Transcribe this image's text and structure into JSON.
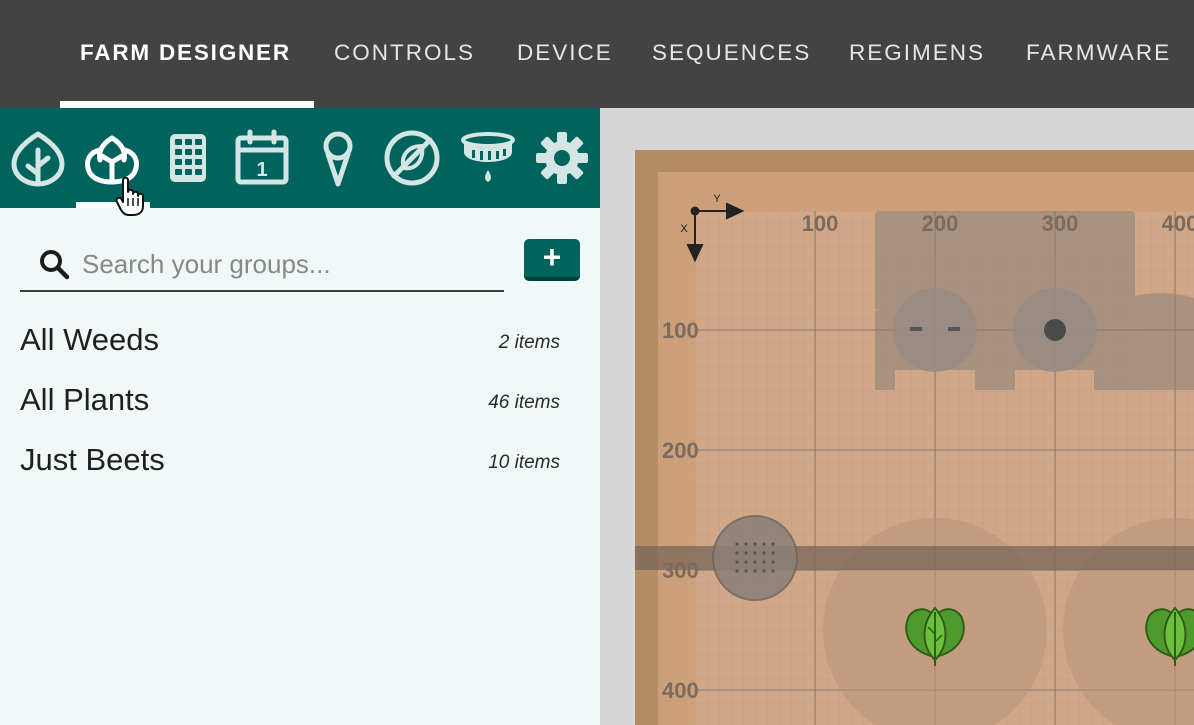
{
  "nav": {
    "tabs": [
      {
        "label": "FARM DESIGNER",
        "active": true
      },
      {
        "label": "CONTROLS"
      },
      {
        "label": "DEVICE"
      },
      {
        "label": "SEQUENCES"
      },
      {
        "label": "REGIMENS"
      },
      {
        "label": "FARMWARE"
      }
    ]
  },
  "panel": {
    "tab_icons": [
      "plants-icon",
      "groups-icon",
      "points-icon",
      "calendar-icon",
      "map-pin-icon",
      "no-weeds-icon",
      "watering-nozzle-icon",
      "settings-gear-icon"
    ],
    "active_tab": "groups-icon",
    "search": {
      "placeholder": "Search your groups...",
      "value": ""
    },
    "add_button_label": "+",
    "groups": [
      {
        "name": "All Weeds",
        "count": "2 items"
      },
      {
        "name": "All Plants",
        "count": "46 items"
      },
      {
        "name": "Just Beets",
        "count": "10 items"
      }
    ]
  },
  "map": {
    "axis_x_label": "X",
    "axis_y_label": "Y",
    "top_ticks": [
      "100",
      "200",
      "300",
      "400"
    ],
    "left_ticks": [
      "100",
      "200",
      "300",
      "400"
    ],
    "colors": {
      "bed_frame": "#b58d63",
      "soil": "#d0a888",
      "grid_major": "#8a7565",
      "accent": "#00635e"
    }
  }
}
